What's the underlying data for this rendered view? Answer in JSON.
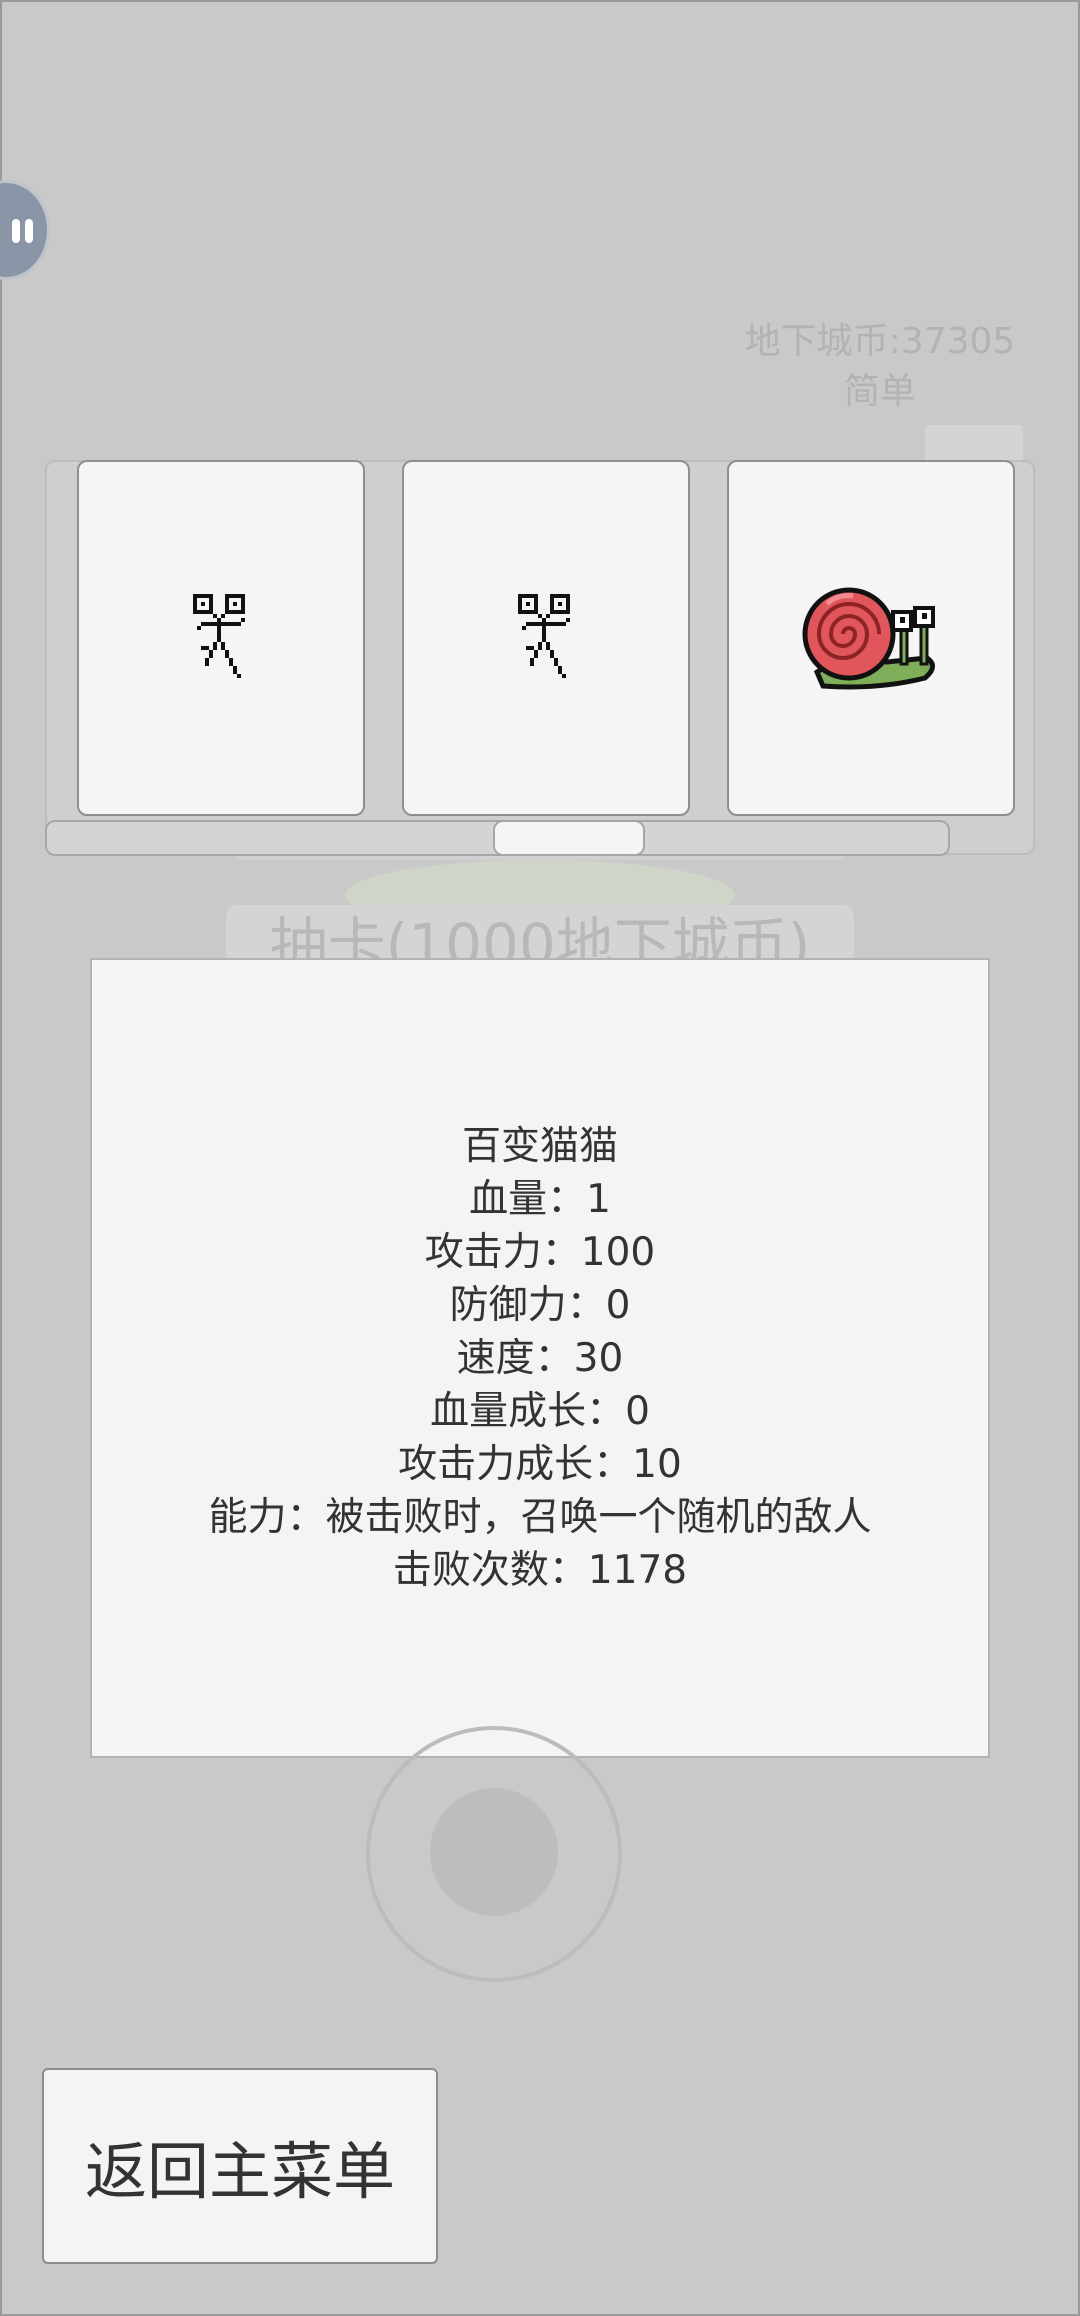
{
  "hud": {
    "coins_label": "地下城币:37305",
    "difficulty_label": "简单"
  },
  "background_button": {
    "label": "抽卡(1000地下城币)"
  },
  "slot": {
    "reels": [
      {
        "icon": "stick-figure-icon"
      },
      {
        "icon": "stick-figure-icon"
      },
      {
        "icon": "snail-icon"
      }
    ]
  },
  "info": {
    "name": "百变猫猫",
    "hp": "血量：1",
    "attack": "攻击力：100",
    "defense": "防御力：0",
    "speed": "速度：30",
    "hp_growth": "血量成长：0",
    "attack_growth": "攻击力成长：10",
    "ability": "能力：被击败时，召唤一个随机的敌人",
    "defeats": "击败次数：1178"
  },
  "buttons": {
    "back_to_menu": "返回主菜单"
  },
  "colors": {
    "background": "#c9c9c9",
    "card": "#f5f5f5",
    "snail_shell": "#e0565b",
    "snail_body": "#7fae5a"
  }
}
